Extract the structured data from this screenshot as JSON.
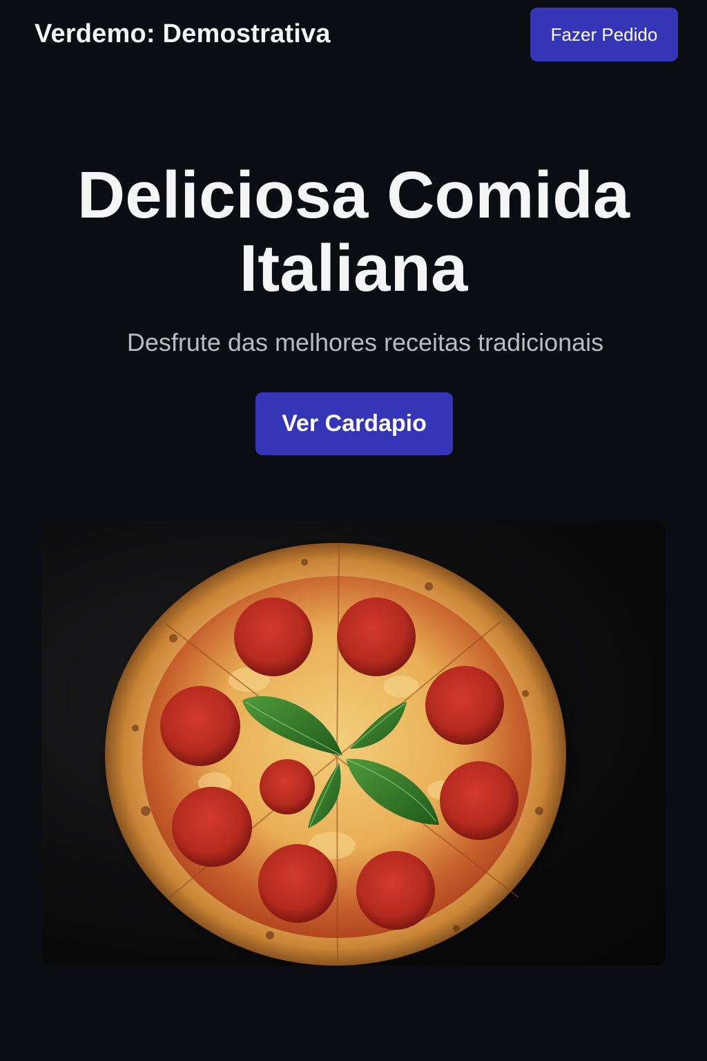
{
  "header": {
    "brand": "Verdemo: Demostrativa",
    "order_button": "Fazer Pedido"
  },
  "hero": {
    "title_line1": "Deliciosa Comida",
    "title_line2": "Italiana",
    "subtitle": "Desfrute das melhores receitas tradicionais",
    "cta_button": "Ver Cardapio"
  },
  "image": {
    "subject": "pepperoni-pizza-with-basil"
  },
  "colors": {
    "background": "#0b0d12",
    "accent": "#3535b8",
    "text": "#f5f5f7",
    "subtext": "#b9bcc6"
  }
}
